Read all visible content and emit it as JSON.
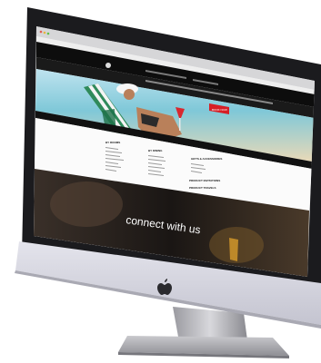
{
  "website": {
    "hero_button": "BOOK NOW",
    "menu_columns": [
      {
        "heading": "BY ROOMS"
      },
      {
        "heading": "BY DINING"
      },
      {
        "heading": "GIFTS & ACCESSORIES"
      }
    ],
    "menu_extra_headings": [
      "PRODUCT INVITATIONS",
      "PRODUCT TRAVELS"
    ],
    "banner_text": "connect with us"
  },
  "device": {
    "logo": "apple-logo-icon"
  }
}
